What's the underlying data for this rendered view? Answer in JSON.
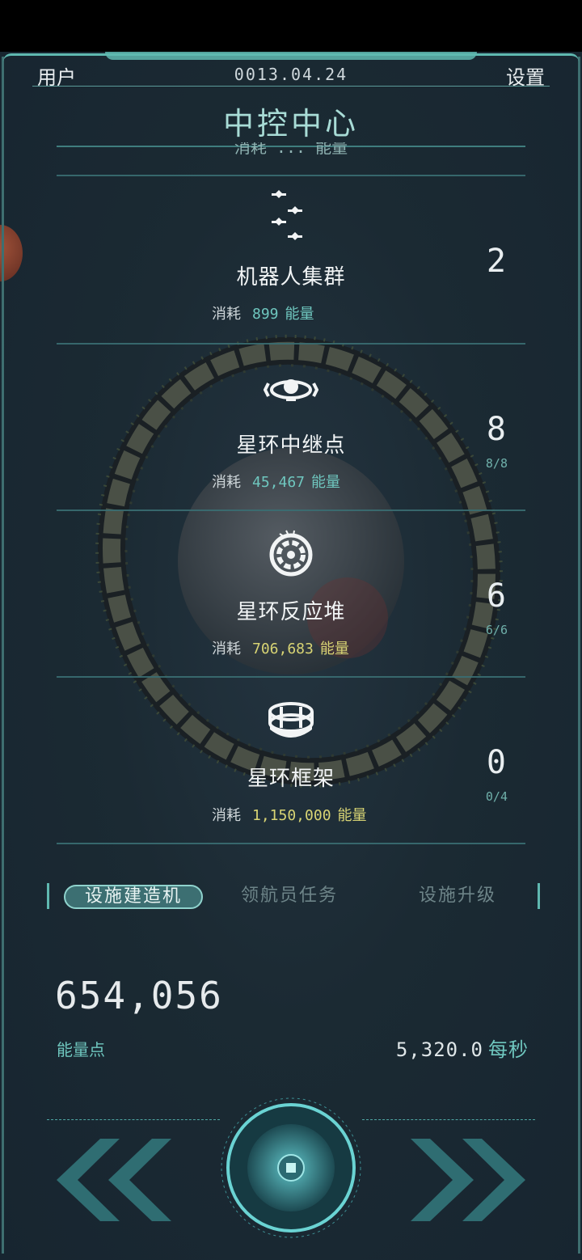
{
  "header": {
    "user_label": "用户",
    "date": "0013.04.24",
    "settings_label": "设置",
    "title": "中控中心"
  },
  "partial_item_text": "消耗 ... 能量",
  "items": [
    {
      "name": "机器人集群",
      "cost_label": "消耗",
      "cost": "899",
      "unit": "能量",
      "count": "2",
      "capacity": "",
      "icon": "robot-swarm-icon",
      "cost_color": "teal"
    },
    {
      "name": "星环中继点",
      "cost_label": "消耗",
      "cost": "45,467",
      "unit": "能量",
      "count": "8",
      "capacity": "8/8",
      "icon": "ring-relay-icon",
      "cost_color": "teal"
    },
    {
      "name": "星环反应堆",
      "cost_label": "消耗",
      "cost": "706,683",
      "unit": "能量",
      "count": "6",
      "capacity": "6/6",
      "icon": "ring-reactor-icon",
      "cost_color": "yellow"
    },
    {
      "name": "星环框架",
      "cost_label": "消耗",
      "cost": "1,150,000",
      "unit": "能量",
      "count": "0",
      "capacity": "0/4",
      "icon": "ring-frame-icon",
      "cost_color": "yellow"
    }
  ],
  "tabs": [
    {
      "label": "设施建造机",
      "active": true
    },
    {
      "label": "领航员任务",
      "active": false
    },
    {
      "label": "设施升级",
      "active": false
    }
  ],
  "energy": {
    "value": "654,056",
    "label": "能量点",
    "rate_value": "5,320.0",
    "rate_unit": "每秒"
  },
  "colors": {
    "accent": "#5fb8b0",
    "teal_text": "#6fc7bf",
    "yellow_text": "#d8d474",
    "background": "#1b2a33"
  },
  "controls": {
    "left_icon": "double-chevron-left-icon",
    "right_icon": "double-chevron-right-icon",
    "center_icon": "center-core-button-icon"
  }
}
